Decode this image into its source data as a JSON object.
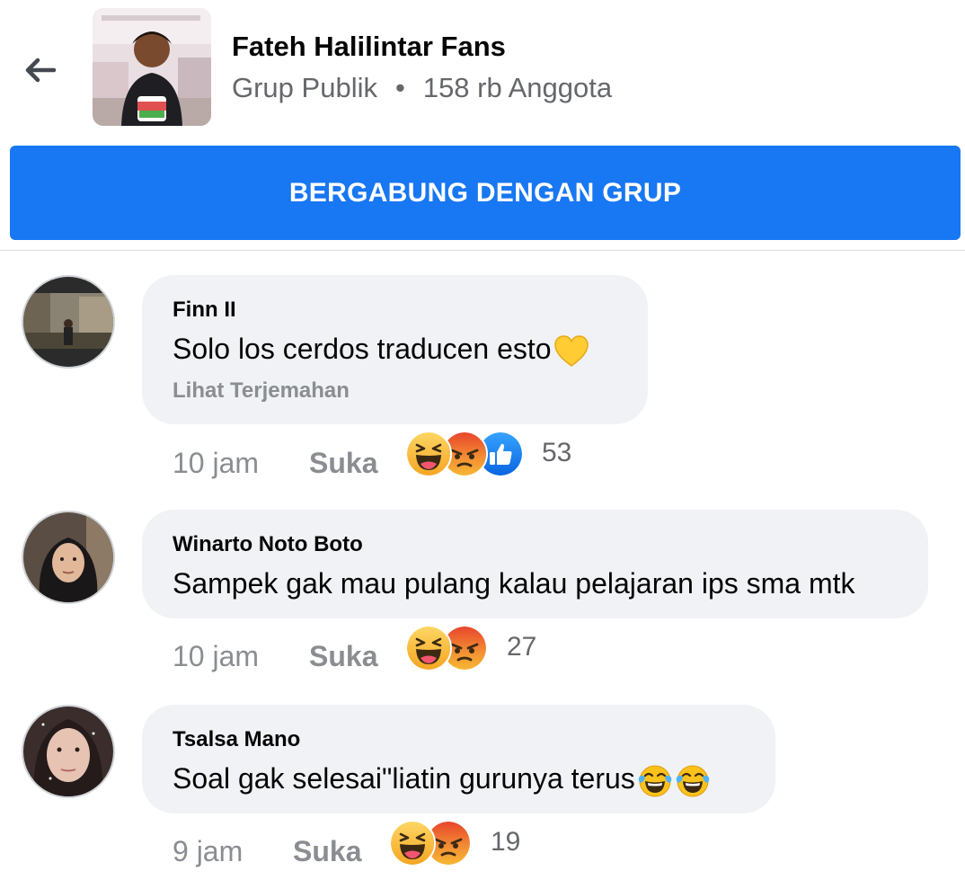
{
  "header": {
    "group_name": "Fateh Halilintar Fans",
    "privacy": "Grup Publik",
    "separator": "•",
    "members": "158 rb Anggota"
  },
  "join_button": {
    "label": "BERGABUNG DENGAN GRUP",
    "color": "#1877f2"
  },
  "comments": [
    {
      "author": "Finn II",
      "text": "Solo los cerdos traducen esto",
      "inline_emoji": [
        "yellow-heart-icon"
      ],
      "translate_link": "Lihat Terjemahan",
      "time": "10 jam",
      "like": "Suka",
      "reactions": [
        "haha-reaction-icon",
        "angry-reaction-icon",
        "like-reaction-icon"
      ],
      "reaction_count": "53"
    },
    {
      "author": "Winarto Noto Boto",
      "text": "Sampek gak mau pulang kalau pelajaran ips sma mtk",
      "time": "10 jam",
      "like": "Suka",
      "reactions": [
        "haha-reaction-icon",
        "angry-reaction-icon"
      ],
      "reaction_count": "27"
    },
    {
      "author": "Tsalsa Mano",
      "text": "Soal gak selesai\"liatin gurunya terus",
      "inline_emoji": [
        "tears-of-joy-icon",
        "tears-of-joy-icon"
      ],
      "time": "9 jam",
      "like": "Suka",
      "reactions": [
        "haha-reaction-icon",
        "angry-reaction-icon"
      ],
      "reaction_count": "19"
    }
  ]
}
